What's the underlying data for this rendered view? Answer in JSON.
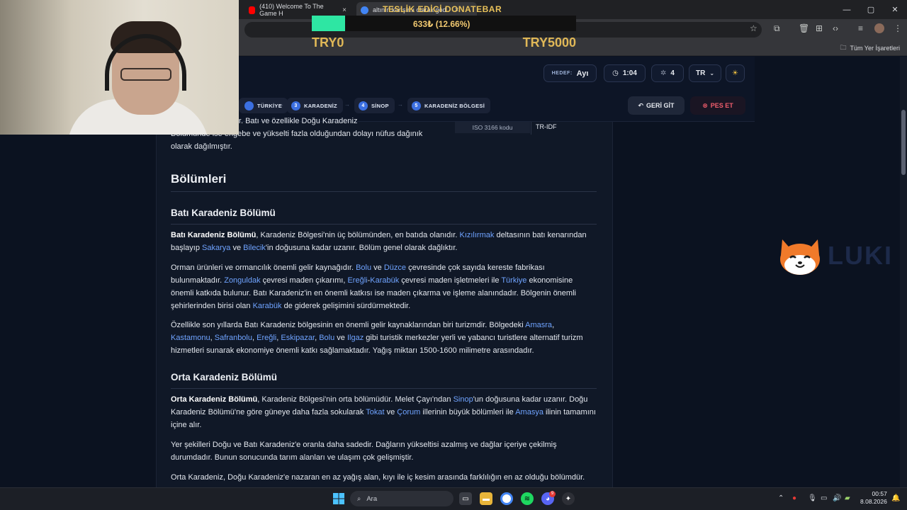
{
  "browser": {
    "tabs": [
      {
        "title": "(410) Welcome To The Game H",
        "close": "×"
      },
      {
        "title": "altının karışımı olarak god",
        "close": "×"
      }
    ],
    "bookmarks_all": "Tüm Yer İşaretleri",
    "window_controls": [
      "—",
      "▢",
      "✕"
    ]
  },
  "donation": {
    "title": "TESLİK EDİCİ DONATEBAR",
    "amount": "633₺ (12.66%)",
    "progress_fraction": 0.1266,
    "min": "TRY0",
    "max": "TRY5000"
  },
  "header": {
    "target_label": "HEDEF:",
    "target_value": "Ayı",
    "timer": "1:04",
    "clicks": "4",
    "language": "TR",
    "language_caret": "⌄"
  },
  "breadcrumb": [
    {
      "num": "",
      "label": "TÜRKİYE"
    },
    {
      "num": "3",
      "label": "KARADENİZ"
    },
    {
      "num": "4",
      "label": "SİNOP"
    },
    {
      "num": "5",
      "label": "KARADENİZ BÖLGESİ"
    }
  ],
  "actions": {
    "back": "GERİ GİT",
    "give_up": "PES ET"
  },
  "infobox": {
    "key": "ISO 3166 kodu",
    "value": "TR-IDF"
  },
  "article": {
    "intro_line1": "olarak serpilmiştir. Batı ve özellikle Doğu Karadeniz",
    "intro_line2": "Bölümünde ise engebe ve yükselti fazla olduğundan dolayı nüfus dağınık",
    "intro_line3": "olarak dağılmıştır.",
    "h_sections": "Bölümleri",
    "h_bati": "Batı Karadeniz Bölümü",
    "bati_p1": {
      "b1": "Batı Karadeniz Bölümü",
      "t1": ", Karadeniz Bölgesi'nin üç bölümünden, en batıda olanıdır. ",
      "l1": "Kızılırmak",
      "t2": " deltasının batı kenarından başlayıp ",
      "l2": "Sakarya",
      "t3": " ve ",
      "l3": "Bilecik",
      "t4": "'in doğusuna kadar uzanır. Bölüm genel olarak dağlıktır."
    },
    "bati_p2": {
      "t1": "Orman ürünleri ve ormancılık önemli gelir kaynağıdır. ",
      "l1": "Bolu",
      "t2": " ve ",
      "l2": "Düzce",
      "t3": " çevresinde çok sayıda kereste fabrikası bulunmaktadır. ",
      "l3": "Zonguldak",
      "t4": " çevresi maden çıkarımı, ",
      "l4": "Ereğli",
      "t5": "-",
      "l5": "Karabük",
      "t6": " çevresi maden işletmeleri ile ",
      "l6": "Türkiye",
      "t7": " ekonomisine önemli katkıda bulunur. Batı Karadeniz'in en önemli katkısı ise maden çıkarma ve işleme alanındadır. Bölgenin önemli şehirlerinden birisi olan ",
      "l7": "Karabük",
      "t8": " de giderek gelişimini sürdürmektedir."
    },
    "bati_p3": {
      "t1": "Özellikle son yıllarda Batı Karadeniz bölgesinin en önemli gelir kaynaklarından biri turizmdir. Bölgedeki ",
      "l1": "Amasra",
      "t2": ", ",
      "l2": "Kastamonu",
      "t3": ", ",
      "l3": "Safranbolu",
      "t4": ", ",
      "l4": "Ereğli",
      "t5": ", ",
      "l5": "Eskipazar",
      "t6": ", ",
      "l6": "Bolu",
      "t7": " ve ",
      "l7": "Ilgaz",
      "t8": " gibi turistik merkezler yerli ve yabancı turistlere alternatif turizm hizmetleri sunarak ekonomiye önemli katkı sağlamaktadır. Yağış miktarı 1500-1600 milimetre arasındadır."
    },
    "h_orta": "Orta Karadeniz Bölümü",
    "orta_p1": {
      "b1": "Orta Karadeniz Bölümü",
      "t1": ", Karadeniz Bölgesi'nin orta bölümüdür. Melet Çayı'ndan ",
      "l1": "Sinop",
      "t2": "'un doğusuna kadar uzanır. Doğu Karadeniz Bölümü'ne göre güneye daha fazla sokularak ",
      "l2": "Tokat",
      "t3": " ve ",
      "l3": "Çorum",
      "t4": " illerinin büyük bölümleri ile ",
      "l4": "Amasya",
      "t5": " ilinin tamamını içine alır."
    },
    "orta_p2": "Yer şekilleri Doğu ve Batı Karadeniz'e oranla daha sadedir. Dağların yükseltisi azalmış ve dağlar içeriye çekilmiş durumdadır. Bunun sonucunda tarım alanları ve ulaşım çok gelişmiştir.",
    "orta_p3": "Orta Karadeniz, Doğu Karadeniz'e nazaran en az yağış alan, kıyı ile iç kesim arasında farklılığın en az olduğu bölümdür."
  },
  "brand": {
    "name": "LUKI"
  },
  "taskbar": {
    "search_placeholder": "Ara",
    "time": "00:57",
    "date": "8.08.2026",
    "discord_badge": "9"
  },
  "colors": {
    "accent_blue": "#3b6fe0",
    "link": "#6fa3ff",
    "danger": "#f05d6c",
    "donate_fill": "#2ee6a3"
  }
}
